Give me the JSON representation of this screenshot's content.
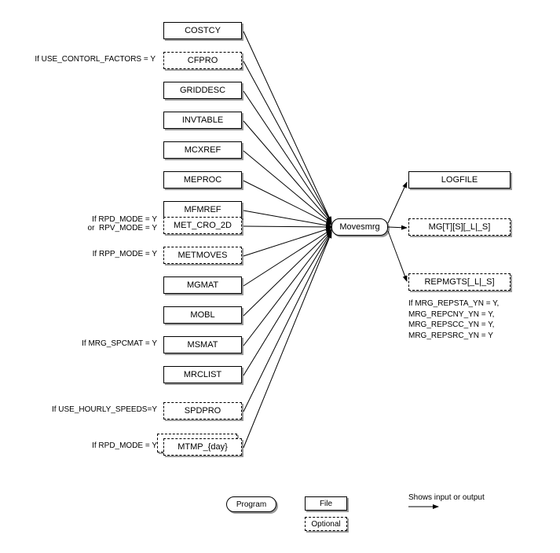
{
  "program": {
    "label": "Movesmrg"
  },
  "inputs": [
    {
      "id": "costcy",
      "label": "COSTCY",
      "optional": false,
      "condition": ""
    },
    {
      "id": "cfpro",
      "label": "CFPRO",
      "optional": true,
      "condition": "If USE_CONTORL_FACTORS = Y"
    },
    {
      "id": "griddesc",
      "label": "GRIDDESC",
      "optional": false,
      "condition": ""
    },
    {
      "id": "invtable",
      "label": "INVTABLE",
      "optional": false,
      "condition": ""
    },
    {
      "id": "mcxref",
      "label": "MCXREF",
      "optional": false,
      "condition": ""
    },
    {
      "id": "meproc",
      "label": "MEPROC",
      "optional": false,
      "condition": ""
    },
    {
      "id": "mfmref",
      "label": "MFMREF",
      "optional": false,
      "condition": ""
    },
    {
      "id": "metcro2d",
      "label": "MET_CRO_2D",
      "optional": true,
      "condition": "If RPD_MODE = Y\nor  RPV_MODE = Y"
    },
    {
      "id": "metmoves",
      "label": "METMOVES",
      "optional": true,
      "condition": "If RPP_MODE = Y"
    },
    {
      "id": "mgmat",
      "label": "MGMAT",
      "optional": false,
      "condition": ""
    },
    {
      "id": "mobl",
      "label": "MOBL",
      "optional": false,
      "condition": ""
    },
    {
      "id": "msmat",
      "label": "MSMAT",
      "optional": false,
      "condition": "If MRG_SPCMAT = Y"
    },
    {
      "id": "mrclist",
      "label": "MRCLIST",
      "optional": false,
      "condition": ""
    },
    {
      "id": "spdpro",
      "label": "SPDPRO",
      "optional": true,
      "condition": "If USE_HOURLY_SPEEDS=Y"
    },
    {
      "id": "mtmp",
      "label": "MTMP_{day}",
      "optional": true,
      "condition": "If RPD_MODE = Y",
      "stacked": true
    }
  ],
  "outputs": [
    {
      "id": "logfile",
      "label": "LOGFILE",
      "optional": false,
      "note": ""
    },
    {
      "id": "mgts",
      "label": "MG[T][S][_L|_S]",
      "optional": true,
      "note": ""
    },
    {
      "id": "repmgts",
      "label": "REPMGTS[_L|_S]",
      "optional": true,
      "note": "If MRG_REPSTA_YN = Y,\nMRG_REPCNY_YN = Y,\nMRG_REPSCC_YN = Y,\nMRG_REPSRC_YN = Y"
    }
  ],
  "legend": {
    "program": "Program",
    "file": "File",
    "optional": "Optional",
    "arrow": "Shows input or output"
  }
}
